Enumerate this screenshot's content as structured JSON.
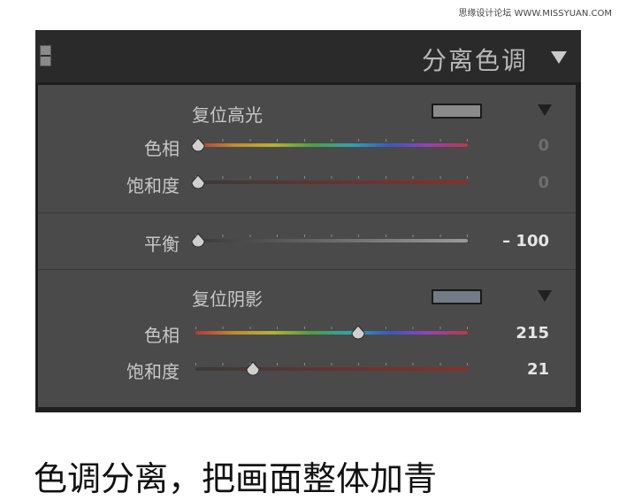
{
  "watermark": "思缘设计论坛 WWW.MISSYUAN.COM",
  "panel": {
    "title": "分离色调",
    "highlights": {
      "title": "复位高光",
      "swatch_color": "#8a8a8a",
      "hue": {
        "label": "色相",
        "value": "0",
        "position": 0.0
      },
      "saturation": {
        "label": "饱和度",
        "value": "0",
        "position": 0.0
      }
    },
    "balance": {
      "label": "平衡",
      "value": "– 100",
      "position": 0.0
    },
    "shadows": {
      "title": "复位阴影",
      "swatch_color": "#727b86",
      "hue": {
        "label": "色相",
        "value": "215",
        "position": 0.597
      },
      "saturation": {
        "label": "饱和度",
        "value": "21",
        "position": 0.21
      }
    }
  },
  "icons": {
    "panel_collapse": "panel-collapse-icon",
    "panel_menu": "triangle-down-icon",
    "section_menu": "triangle-down-icon",
    "slider_knob": "slider-thumb-icon"
  },
  "caption": "色调分离，把画面整体加青"
}
